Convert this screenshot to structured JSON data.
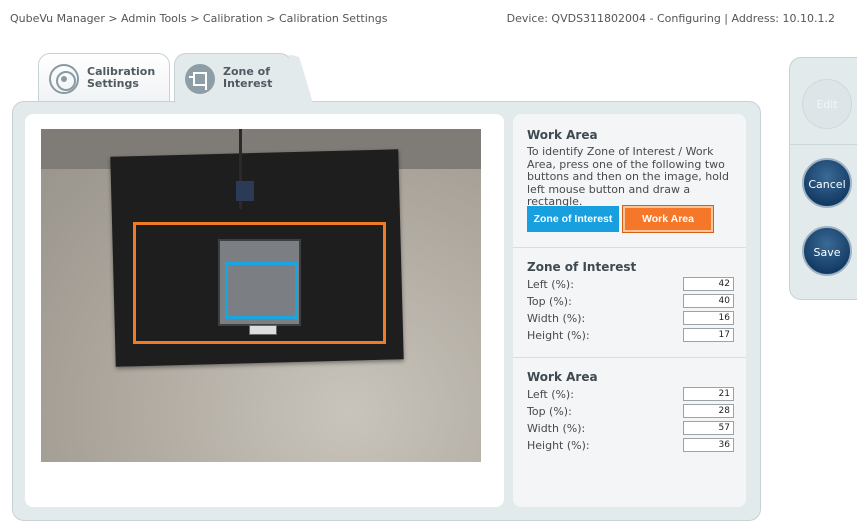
{
  "header": {
    "breadcrumb": "QubeVu Manager > Admin Tools > Calibration > Calibration Settings",
    "device_info": "Device: QVDS311802004 - Configuring | Address: 10.10.1.2"
  },
  "tabs": [
    {
      "label": "Calibration Settings",
      "icon": "target-icon"
    },
    {
      "label": "Zone of Interest",
      "icon": "crop-icon"
    }
  ],
  "work_area_section": {
    "title": "Work Area",
    "description": "To identify Zone of Interest / Work Area, press one of the following two buttons and then on the image, hold left mouse button and draw a rectangle.",
    "zoi_button": "Zone of Interest",
    "work_button": "Work Area"
  },
  "zone_of_interest": {
    "title": "Zone of Interest",
    "fields": [
      {
        "label": "Left (%):",
        "value": "42"
      },
      {
        "label": "Top (%):",
        "value": "40"
      },
      {
        "label": "Width (%):",
        "value": "16"
      },
      {
        "label": "Height (%):",
        "value": "17"
      }
    ]
  },
  "work_area": {
    "title": "Work Area",
    "fields": [
      {
        "label": "Left (%):",
        "value": "21"
      },
      {
        "label": "Top (%):",
        "value": "28"
      },
      {
        "label": "Width (%):",
        "value": "57"
      },
      {
        "label": "Height (%):",
        "value": "36"
      }
    ]
  },
  "actions": {
    "edit": "Edit",
    "cancel": "Cancel",
    "save": "Save"
  },
  "colors": {
    "zoi": "#1aa5e0",
    "work_area": "#f07b24",
    "action_button": "#123a63"
  }
}
